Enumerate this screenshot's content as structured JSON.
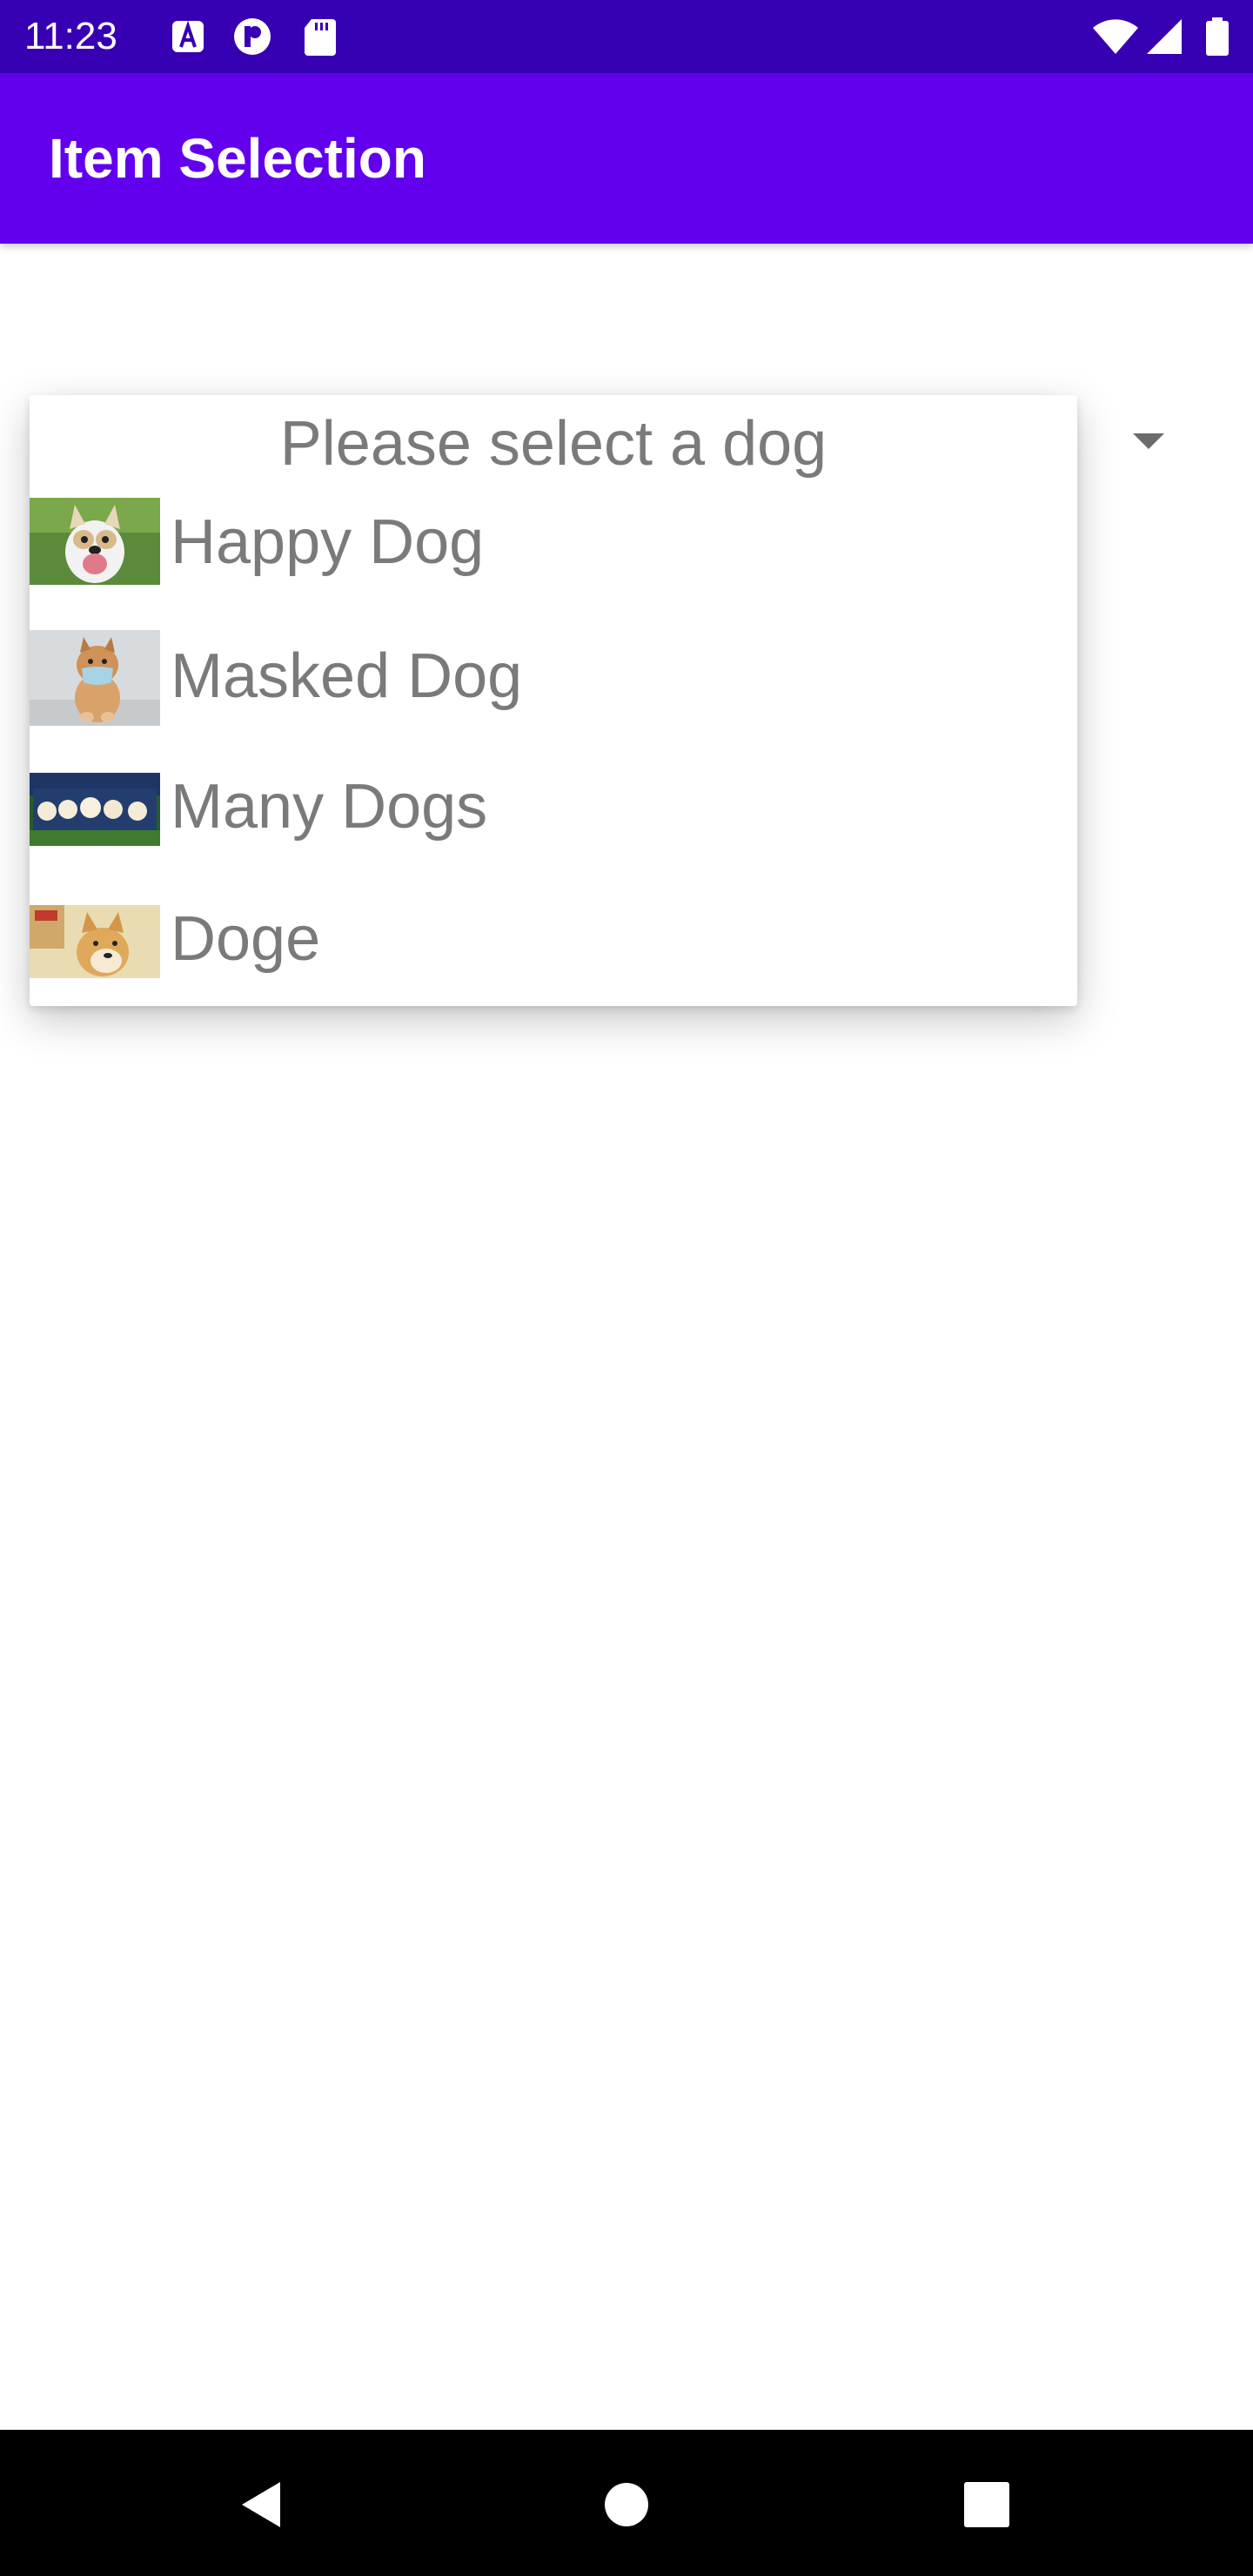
{
  "status_bar": {
    "time": "11:23",
    "icons": [
      "a-letter-icon",
      "p-circle-icon",
      "sd-card-icon",
      "wifi-icon",
      "signal-icon",
      "battery-icon"
    ]
  },
  "app_bar": {
    "title": "Item Selection",
    "color": "#6200ee",
    "status_color": "#3700b3"
  },
  "dropdown": {
    "header": "Please select a dog",
    "items": [
      {
        "label": "Happy Dog",
        "image": "happy-dog-photo"
      },
      {
        "label": "Masked Dog",
        "image": "masked-dog-photo"
      },
      {
        "label": "Many Dogs",
        "image": "many-dogs-photo"
      },
      {
        "label": "Doge",
        "image": "doge-photo"
      }
    ]
  },
  "nav_bar": {
    "buttons": [
      "back-icon",
      "home-icon",
      "recents-icon"
    ]
  }
}
